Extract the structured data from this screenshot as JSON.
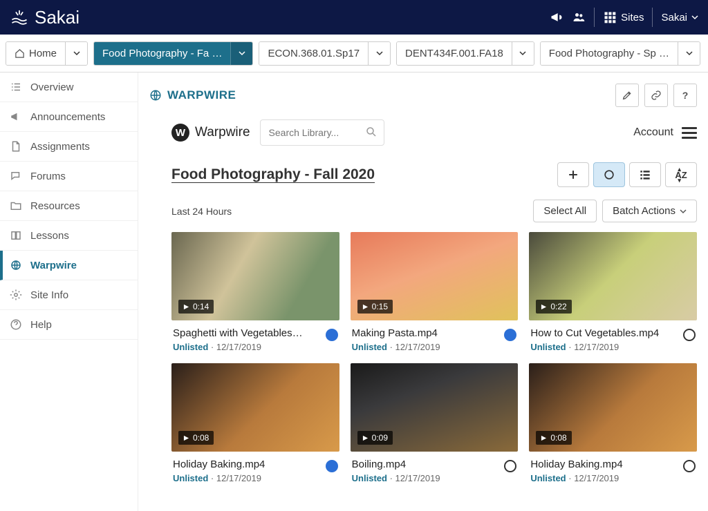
{
  "topbar": {
    "brand": "Sakai",
    "sites_label": "Sites",
    "user_label": "Sakai"
  },
  "tabs": [
    {
      "label": "Home",
      "icon": "home",
      "active": false
    },
    {
      "label": "Food Photography - Fa …",
      "active": true
    },
    {
      "label": "ECON.368.01.Sp17",
      "active": false
    },
    {
      "label": "DENT434F.001.FA18",
      "active": false
    },
    {
      "label": "Food Photography - Sp …",
      "active": false
    }
  ],
  "sidebar": [
    {
      "label": "Overview",
      "icon": "list"
    },
    {
      "label": "Announcements",
      "icon": "megaphone"
    },
    {
      "label": "Assignments",
      "icon": "file"
    },
    {
      "label": "Forums",
      "icon": "comments"
    },
    {
      "label": "Resources",
      "icon": "folder"
    },
    {
      "label": "Lessons",
      "icon": "book"
    },
    {
      "label": "Warpwire",
      "icon": "globe",
      "active": true
    },
    {
      "label": "Site Info",
      "icon": "gear"
    },
    {
      "label": "Help",
      "icon": "question"
    }
  ],
  "content_header": {
    "title": "WARPWIRE"
  },
  "warpwire": {
    "brand": "Warpwire",
    "search_placeholder": "Search Library...",
    "account_label": "Account",
    "library_title": "Food Photography - Fall 2020",
    "section_label": "Last 24 Hours",
    "select_all_label": "Select All",
    "batch_actions_label": "Batch Actions"
  },
  "videos": [
    {
      "title": "Spaghetti with Vegetables…",
      "duration": "0:14",
      "status": "Unlisted",
      "date": "12/17/2019",
      "selected": true,
      "thumb": "t0"
    },
    {
      "title": "Making Pasta.mp4",
      "duration": "0:15",
      "status": "Unlisted",
      "date": "12/17/2019",
      "selected": true,
      "thumb": "t1"
    },
    {
      "title": "How to Cut Vegetables.mp4",
      "duration": "0:22",
      "status": "Unlisted",
      "date": "12/17/2019",
      "selected": false,
      "thumb": "t2"
    },
    {
      "title": "Holiday Baking.mp4",
      "duration": "0:08",
      "status": "Unlisted",
      "date": "12/17/2019",
      "selected": true,
      "thumb": "t3"
    },
    {
      "title": "Boiling.mp4",
      "duration": "0:09",
      "status": "Unlisted",
      "date": "12/17/2019",
      "selected": false,
      "thumb": "t4"
    },
    {
      "title": "Holiday Baking.mp4",
      "duration": "0:08",
      "status": "Unlisted",
      "date": "12/17/2019",
      "selected": false,
      "thumb": "t5"
    }
  ]
}
